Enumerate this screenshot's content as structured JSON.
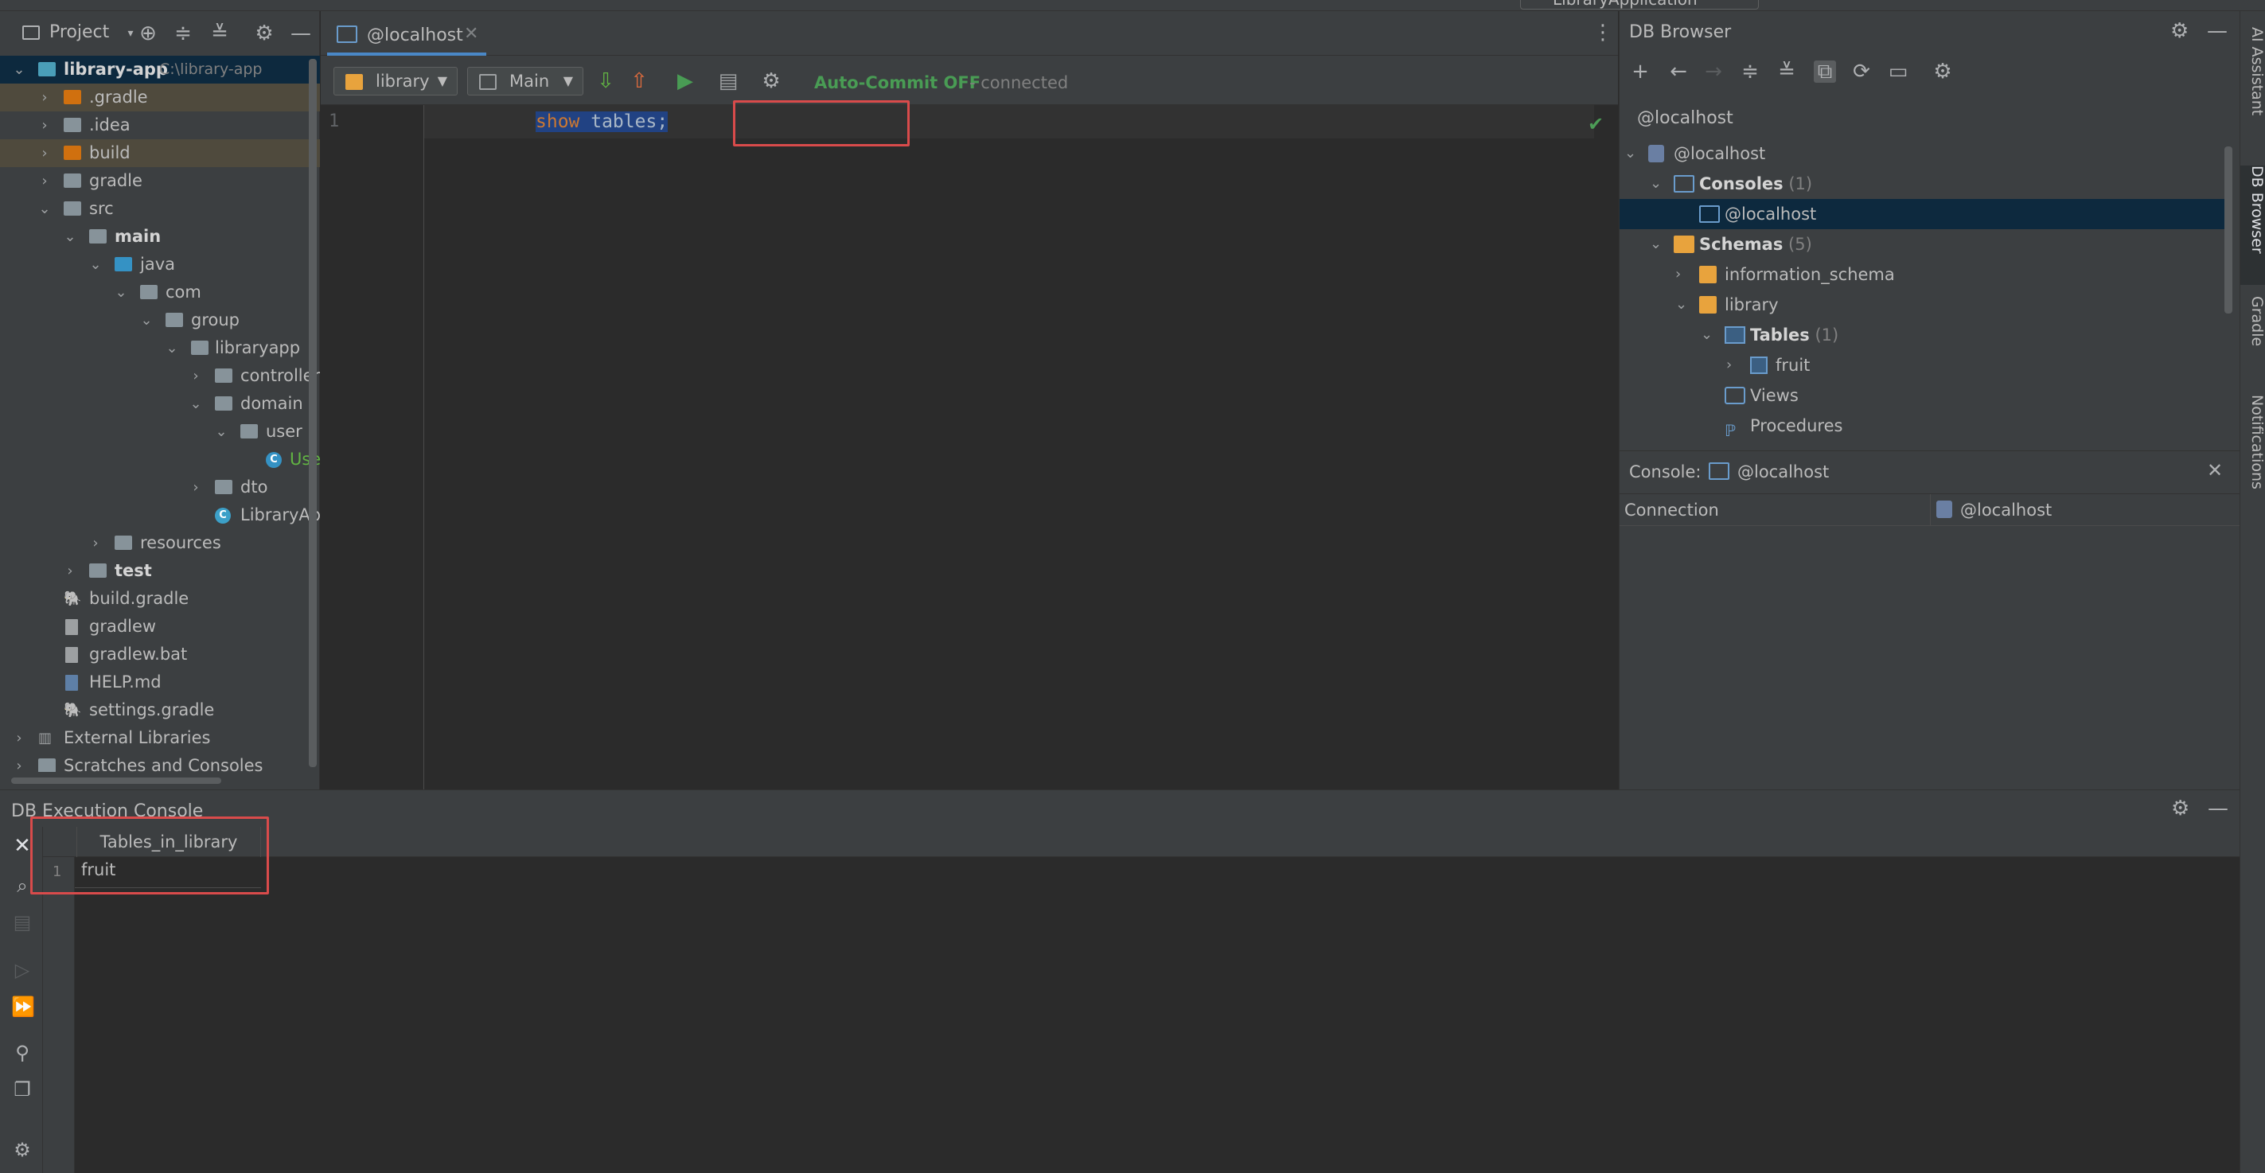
{
  "run_config": {
    "label": "LibraryApplication"
  },
  "project": {
    "title": "Project",
    "tree": [
      {
        "label": "library-app",
        "path": "C:\\library-app",
        "bold": true
      },
      {
        "label": ".gradle"
      },
      {
        "label": ".idea"
      },
      {
        "label": "build"
      },
      {
        "label": "gradle"
      },
      {
        "label": "src"
      },
      {
        "label": "main",
        "bold": true
      },
      {
        "label": "java"
      },
      {
        "label": "com"
      },
      {
        "label": "group"
      },
      {
        "label": "libraryapp"
      },
      {
        "label": "controller"
      },
      {
        "label": "domain"
      },
      {
        "label": "user"
      },
      {
        "label": "User"
      },
      {
        "label": "dto"
      },
      {
        "label": "LibraryApp"
      },
      {
        "label": "resources"
      },
      {
        "label": "test",
        "bold": true
      },
      {
        "label": "build.gradle"
      },
      {
        "label": "gradlew"
      },
      {
        "label": "gradlew.bat"
      },
      {
        "label": "HELP.md"
      },
      {
        "label": "settings.gradle"
      },
      {
        "label": "External Libraries"
      },
      {
        "label": "Scratches and Consoles"
      }
    ]
  },
  "editor": {
    "tab_title": "@localhost",
    "schema_combo": "library",
    "session_combo": "Main",
    "autocommit": "Auto-Commit OFF",
    "status": "- connected",
    "line_number": "1",
    "code_keyword": "show",
    "code_rest": " tables;"
  },
  "db_browser": {
    "title": "DB Browser",
    "connection": "@localhost",
    "tree": {
      "root": "@localhost",
      "consoles_label": "Consoles",
      "consoles_count": "(1)",
      "console_item": "@localhost",
      "schemas_label": "Schemas",
      "schemas_count": "(5)",
      "schema_info": "information_schema",
      "schema_library": "library",
      "tables_label": "Tables",
      "tables_count": "(1)",
      "table_fruit": "fruit",
      "views": "Views",
      "procedures": "Procedures"
    },
    "console_panel": {
      "title": "Console:",
      "name": "@localhost",
      "prop_label": "Connection",
      "prop_value": "@localhost"
    }
  },
  "right_stripe": [
    "AI Assistant",
    "DB Browser",
    "Gradle",
    "Notifications"
  ],
  "bottom": {
    "title": "DB Execution Console",
    "column": "Tables_in_library",
    "row_number": "1",
    "row_value": "fruit"
  },
  "colors": {
    "accent": "#4a88c7",
    "highlight_box": "#d94b4b",
    "ok_green": "#499c54"
  }
}
